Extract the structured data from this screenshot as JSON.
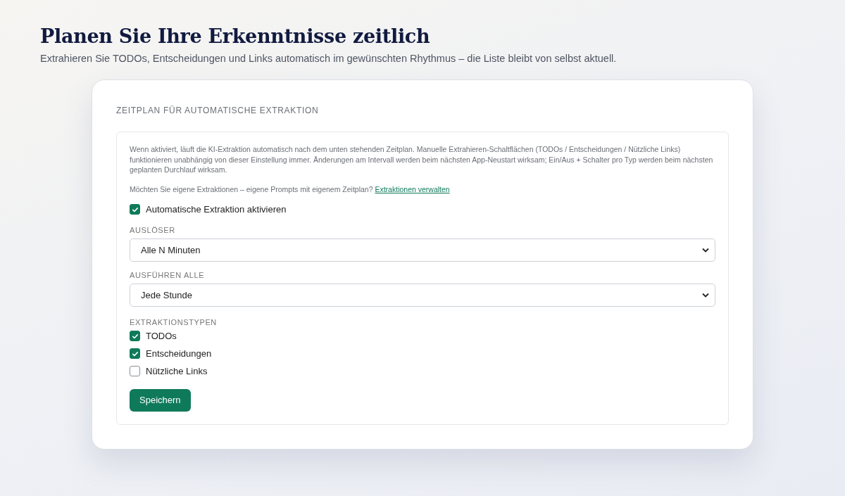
{
  "page": {
    "title": "Planen Sie Ihre Erkenntnisse zeitlich",
    "subtitle": "Extrahieren Sie TODOs, Entscheidungen und Links automatisch im gewünschten Rhythmus – die Liste bleibt von selbst aktuell."
  },
  "card": {
    "heading": "ZEITPLAN FÜR AUTOMATISCHE EXTRAKTION",
    "description": "Wenn aktiviert, läuft die KI-Extraktion automatisch nach dem unten stehenden Zeitplan. Manuelle Extrahieren-Schaltflächen (TODOs / Entscheidungen / Nützliche Links) funktionieren unabhängig von dieser Einstellung immer. Änderungen am Intervall werden beim nächsten App-Neustart wirksam; Ein/Aus + Schalter pro Typ werden beim nächsten geplanten Durchlauf wirksam.",
    "custom_prompt": {
      "text": "Möchten Sie eigene Extraktionen – eigene Prompts mit eigenem Zeitplan?",
      "link": "Extraktionen verwalten"
    },
    "enable": {
      "label": "Automatische Extraktion aktivieren",
      "checked": true
    },
    "fields": [
      {
        "label": "AUSLÖSER",
        "value": "Alle N Minuten"
      },
      {
        "label": "AUSFÜHREN ALLE",
        "value": "Jede Stunde"
      }
    ],
    "types_label": "EXTRAKTIONSTYPEN",
    "types": [
      {
        "label": "TODOs",
        "checked": true
      },
      {
        "label": "Entscheidungen",
        "checked": true
      },
      {
        "label": "Nützliche Links",
        "checked": false
      }
    ],
    "save_button": "Speichern"
  }
}
